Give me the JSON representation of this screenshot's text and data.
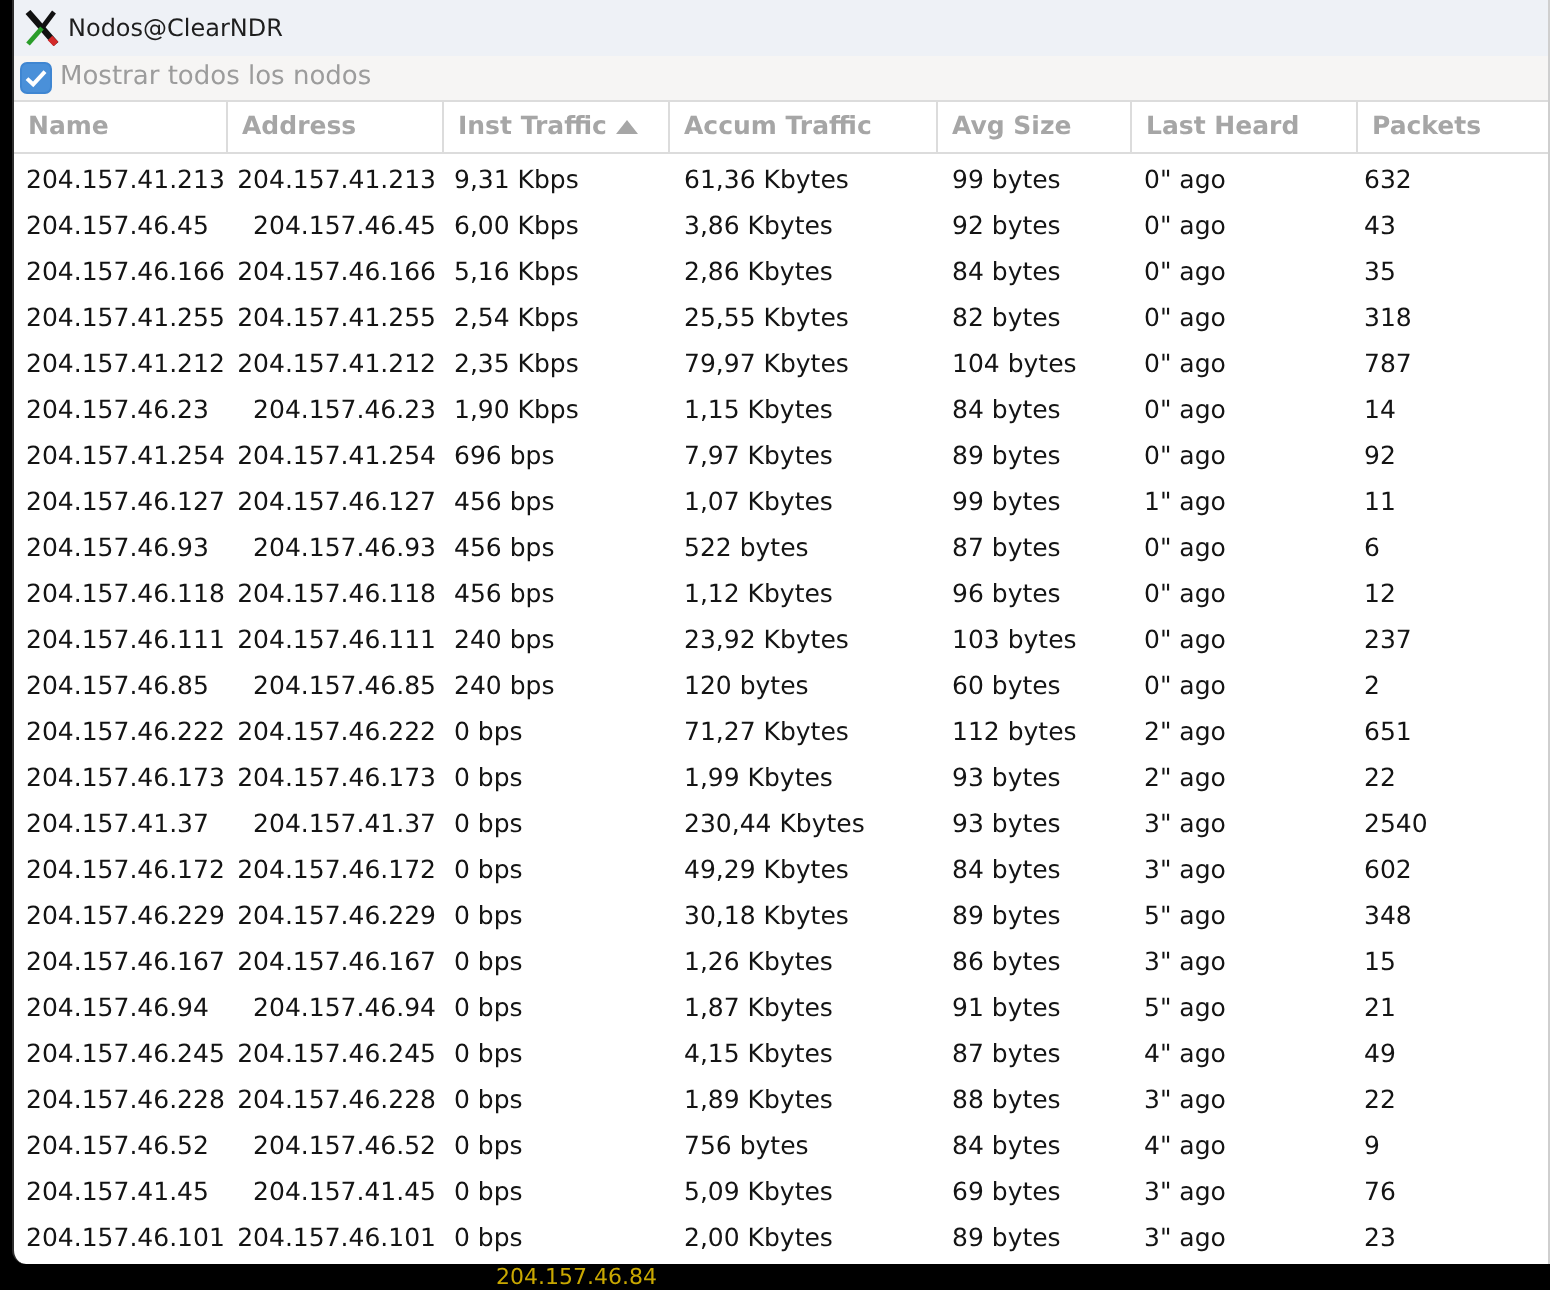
{
  "window": {
    "title": "Nodos@ClearNDR"
  },
  "show_all_nodes": {
    "label": "Mostrar todos los nodos",
    "checked": true
  },
  "table": {
    "columns": [
      {
        "label": "Name",
        "sorted": false
      },
      {
        "label": "Address",
        "sorted": false
      },
      {
        "label": "Inst Traffic",
        "sorted": true
      },
      {
        "label": "Accum Traffic",
        "sorted": false
      },
      {
        "label": "Avg Size",
        "sorted": false
      },
      {
        "label": "Last Heard",
        "sorted": false
      },
      {
        "label": "Packets",
        "sorted": false
      }
    ],
    "rows": [
      [
        "204.157.41.213",
        "204.157.41.213",
        "9,31 Kbps",
        "61,36 Kbytes",
        "99 bytes",
        "0\" ago",
        "632"
      ],
      [
        "204.157.46.45",
        "204.157.46.45",
        "6,00 Kbps",
        "3,86 Kbytes",
        "92 bytes",
        "0\" ago",
        "43"
      ],
      [
        "204.157.46.166",
        "204.157.46.166",
        "5,16 Kbps",
        "2,86 Kbytes",
        "84 bytes",
        "0\" ago",
        "35"
      ],
      [
        "204.157.41.255",
        "204.157.41.255",
        "2,54 Kbps",
        "25,55 Kbytes",
        "82 bytes",
        "0\" ago",
        "318"
      ],
      [
        "204.157.41.212",
        "204.157.41.212",
        "2,35 Kbps",
        "79,97 Kbytes",
        "104 bytes",
        "0\" ago",
        "787"
      ],
      [
        "204.157.46.23",
        "204.157.46.23",
        "1,90 Kbps",
        "1,15 Kbytes",
        "84 bytes",
        "0\" ago",
        "14"
      ],
      [
        "204.157.41.254",
        "204.157.41.254",
        "696 bps",
        "7,97 Kbytes",
        "89 bytes",
        "0\" ago",
        "92"
      ],
      [
        "204.157.46.127",
        "204.157.46.127",
        "456 bps",
        "1,07 Kbytes",
        "99 bytes",
        "1\" ago",
        "11"
      ],
      [
        "204.157.46.93",
        "204.157.46.93",
        "456 bps",
        "522 bytes",
        "87 bytes",
        "0\" ago",
        "6"
      ],
      [
        "204.157.46.118",
        "204.157.46.118",
        "456 bps",
        "1,12 Kbytes",
        "96 bytes",
        "0\" ago",
        "12"
      ],
      [
        "204.157.46.111",
        "204.157.46.111",
        "240 bps",
        "23,92 Kbytes",
        "103 bytes",
        "0\" ago",
        "237"
      ],
      [
        "204.157.46.85",
        "204.157.46.85",
        "240 bps",
        "120 bytes",
        "60 bytes",
        "0\" ago",
        "2"
      ],
      [
        "204.157.46.222",
        "204.157.46.222",
        "0 bps",
        "71,27 Kbytes",
        "112 bytes",
        "2\" ago",
        "651"
      ],
      [
        "204.157.46.173",
        "204.157.46.173",
        "0 bps",
        "1,99 Kbytes",
        "93 bytes",
        "2\" ago",
        "22"
      ],
      [
        "204.157.41.37",
        "204.157.41.37",
        "0 bps",
        "230,44 Kbytes",
        "93 bytes",
        "3\" ago",
        "2540"
      ],
      [
        "204.157.46.172",
        "204.157.46.172",
        "0 bps",
        "49,29 Kbytes",
        "84 bytes",
        "3\" ago",
        "602"
      ],
      [
        "204.157.46.229",
        "204.157.46.229",
        "0 bps",
        "30,18 Kbytes",
        "89 bytes",
        "5\" ago",
        "348"
      ],
      [
        "204.157.46.167",
        "204.157.46.167",
        "0 bps",
        "1,26 Kbytes",
        "86 bytes",
        "3\" ago",
        "15"
      ],
      [
        "204.157.46.94",
        "204.157.46.94",
        "0 bps",
        "1,87 Kbytes",
        "91 bytes",
        "5\" ago",
        "21"
      ],
      [
        "204.157.46.245",
        "204.157.46.245",
        "0 bps",
        "4,15 Kbytes",
        "87 bytes",
        "4\" ago",
        "49"
      ],
      [
        "204.157.46.228",
        "204.157.46.228",
        "0 bps",
        "1,89 Kbytes",
        "88 bytes",
        "3\" ago",
        "22"
      ],
      [
        "204.157.46.52",
        "204.157.46.52",
        "0 bps",
        "756 bytes",
        "84 bytes",
        "4\" ago",
        "9"
      ],
      [
        "204.157.41.45",
        "204.157.41.45",
        "0 bps",
        "5,09 Kbytes",
        "69 bytes",
        "3\" ago",
        "76"
      ],
      [
        "204.157.46.101",
        "204.157.46.101",
        "0 bps",
        "2,00 Kbytes",
        "89 bytes",
        "3\" ago",
        "23"
      ]
    ]
  },
  "background": {
    "node_label": "204.157.46.84"
  }
}
